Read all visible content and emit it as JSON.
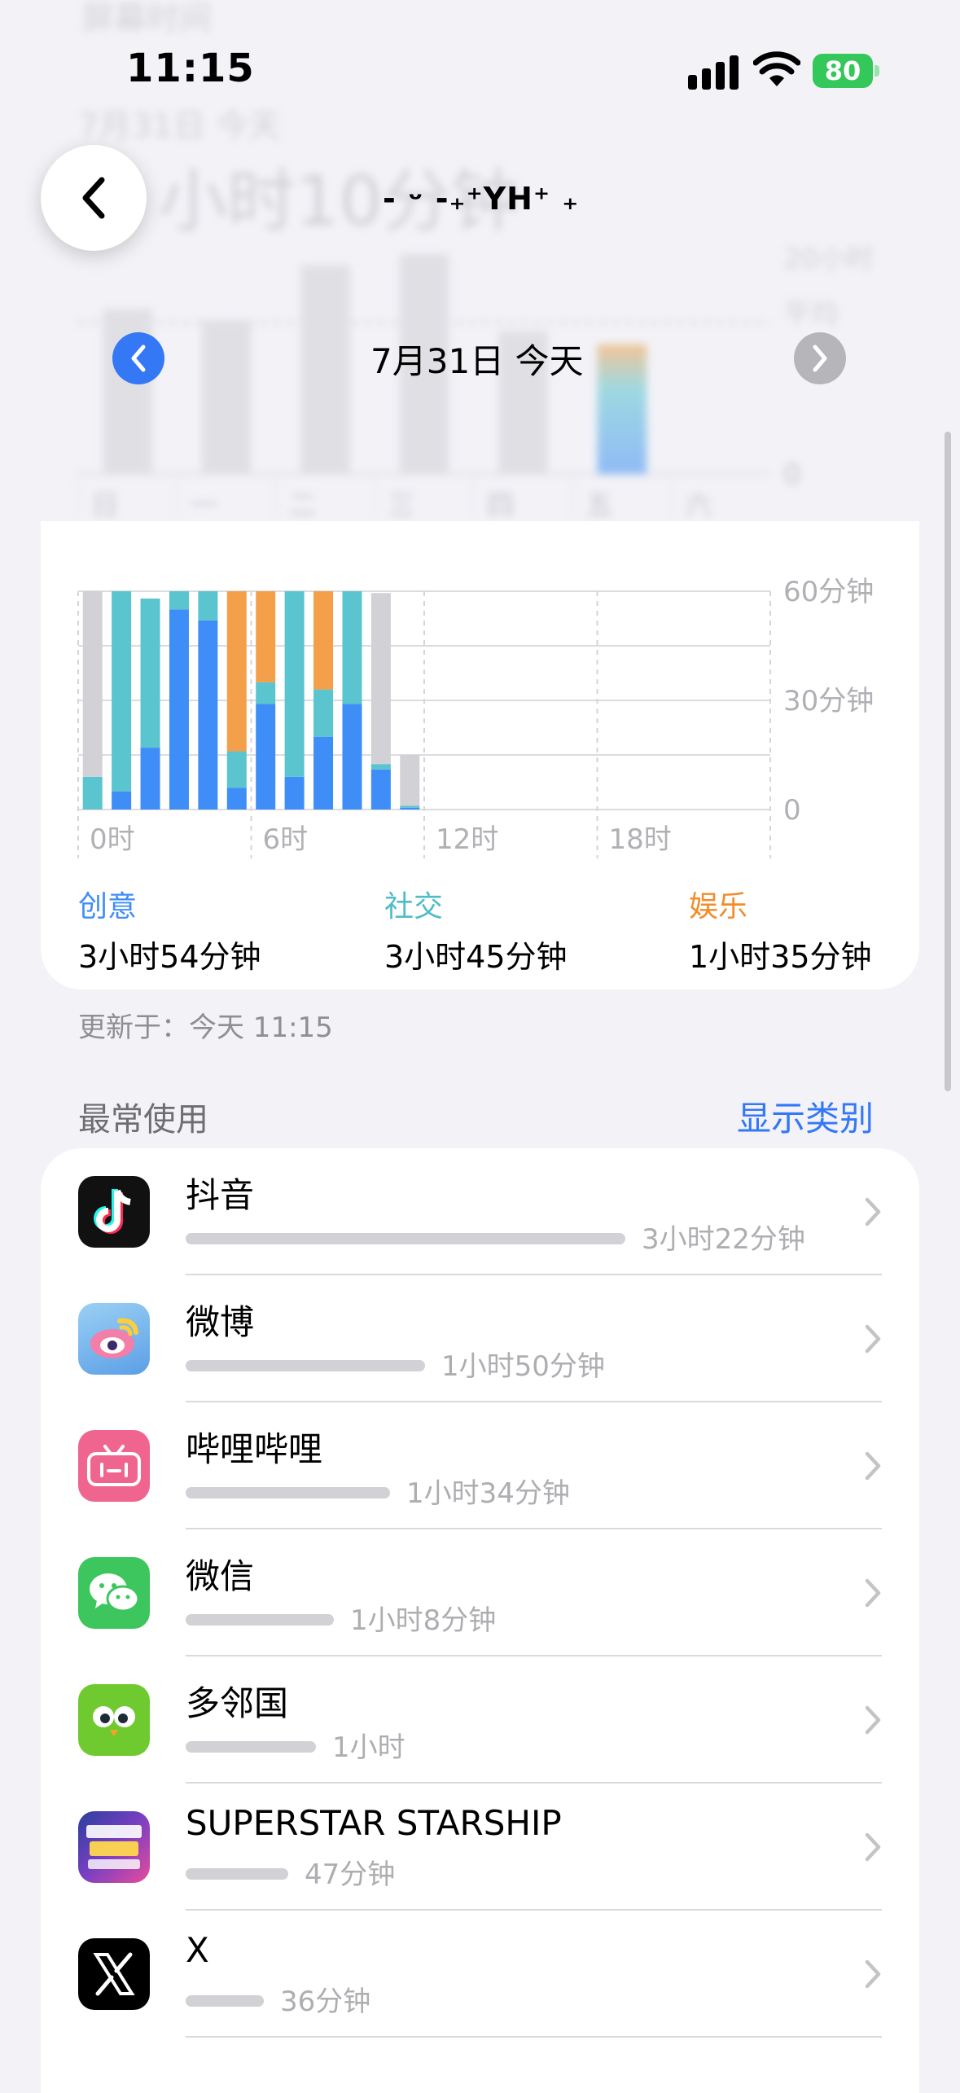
{
  "status": {
    "time": "11:15",
    "battery": "80"
  },
  "background": {
    "section_label": "屏幕时间",
    "date": "7月31日 今天",
    "total": "小时10分钟",
    "axis_top": "20小时",
    "axis_avg": "平均",
    "axis_zero": "0"
  },
  "header": {
    "title": "- ᵕ -₊⁺YH⁺ ₊"
  },
  "date_nav": {
    "label": "7月31日 今天"
  },
  "weekly_chart": {
    "days": [
      "日",
      "一",
      "二",
      "三",
      "四",
      "五",
      "六"
    ],
    "bars_hours": [
      15,
      14,
      19,
      20,
      13,
      11.8,
      0
    ],
    "colors": {
      "grey": "#d1d1d6",
      "blue": "#3f8ef7",
      "teal": "#5ac4cf",
      "orange": "#f4a04b"
    }
  },
  "chart_data": {
    "type": "bar",
    "stacked": true,
    "x_ticks": [
      "0时",
      "6时",
      "12时",
      "18时"
    ],
    "y_ticks": [
      "60分钟",
      "30分钟",
      "0"
    ],
    "ylim": [
      0,
      60
    ],
    "x_hours": [
      0,
      1,
      2,
      3,
      4,
      5,
      6,
      7,
      8,
      9,
      10,
      11
    ],
    "series": [
      {
        "name": "创意",
        "color": "#3f8ef7",
        "values": [
          0,
          5,
          17,
          55,
          52,
          6,
          29,
          9,
          20,
          29,
          11,
          0.5
        ]
      },
      {
        "name": "社交",
        "color": "#5ac4cf",
        "values": [
          9,
          55,
          41,
          5,
          8,
          10,
          6,
          51,
          13,
          31,
          1.5,
          0.5
        ]
      },
      {
        "name": "娱乐",
        "color": "#f4a04b",
        "values": [
          0,
          0,
          0,
          0,
          0,
          44,
          25,
          0,
          27,
          0,
          0,
          0
        ]
      },
      {
        "name": "",
        "color": "#d1d1d6",
        "values": [
          51,
          0,
          0,
          0,
          0,
          0,
          0,
          0,
          0,
          0,
          47,
          14
        ]
      }
    ]
  },
  "legend": [
    {
      "label": "创意",
      "value": "3小时54分钟",
      "color": "#3f8ef7"
    },
    {
      "label": "社交",
      "value": "3小时45分钟",
      "color": "#4fbcc8"
    },
    {
      "label": "娱乐",
      "value": "1小时35分钟",
      "color": "#f28c28"
    }
  ],
  "updated": "更新于：今天 11:15",
  "most_used": {
    "title": "最常使用",
    "show_categories": "显示类别",
    "apps": [
      {
        "name": "抖音",
        "time": "3小时22分钟",
        "fraction": 1.0,
        "icon": "douyin-icon"
      },
      {
        "name": "微博",
        "time": "1小时50分钟",
        "fraction": 0.545,
        "icon": "weibo-icon"
      },
      {
        "name": "哔哩哔哩",
        "time": "1小时34分钟",
        "fraction": 0.465,
        "icon": "bilibili-icon"
      },
      {
        "name": "微信",
        "time": "1小时8分钟",
        "fraction": 0.337,
        "icon": "wechat-icon"
      },
      {
        "name": "多邻国",
        "time": "1小时",
        "fraction": 0.297,
        "icon": "duolingo-icon"
      },
      {
        "name": "SUPERSTAR STARSHIP",
        "time": "47分钟",
        "fraction": 0.233,
        "icon": "superstar-icon"
      },
      {
        "name": "X",
        "time": "36分钟",
        "fraction": 0.178,
        "icon": "x-icon"
      }
    ]
  }
}
